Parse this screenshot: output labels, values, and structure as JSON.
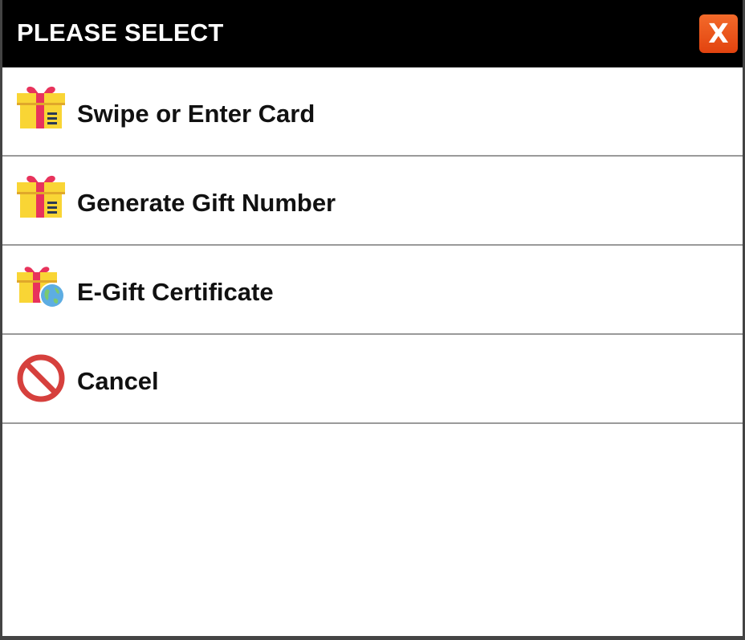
{
  "dialog": {
    "title": "PLEASE SELECT",
    "close_label": "X"
  },
  "menu": {
    "items": [
      {
        "label": "Swipe or Enter Card",
        "icon": "gift-card-icon"
      },
      {
        "label": "Generate Gift Number",
        "icon": "gift-card-icon"
      },
      {
        "label": "E-Gift Certificate",
        "icon": "gift-globe-icon"
      },
      {
        "label": "Cancel",
        "icon": "prohibited-icon"
      }
    ]
  },
  "colors": {
    "titlebar": "#000000",
    "close_button": "#f0531f",
    "gift_box": "#f9d535",
    "gift_ribbon": "#e8335c",
    "globe": "#5dade2",
    "prohibited": "#d6403d"
  }
}
